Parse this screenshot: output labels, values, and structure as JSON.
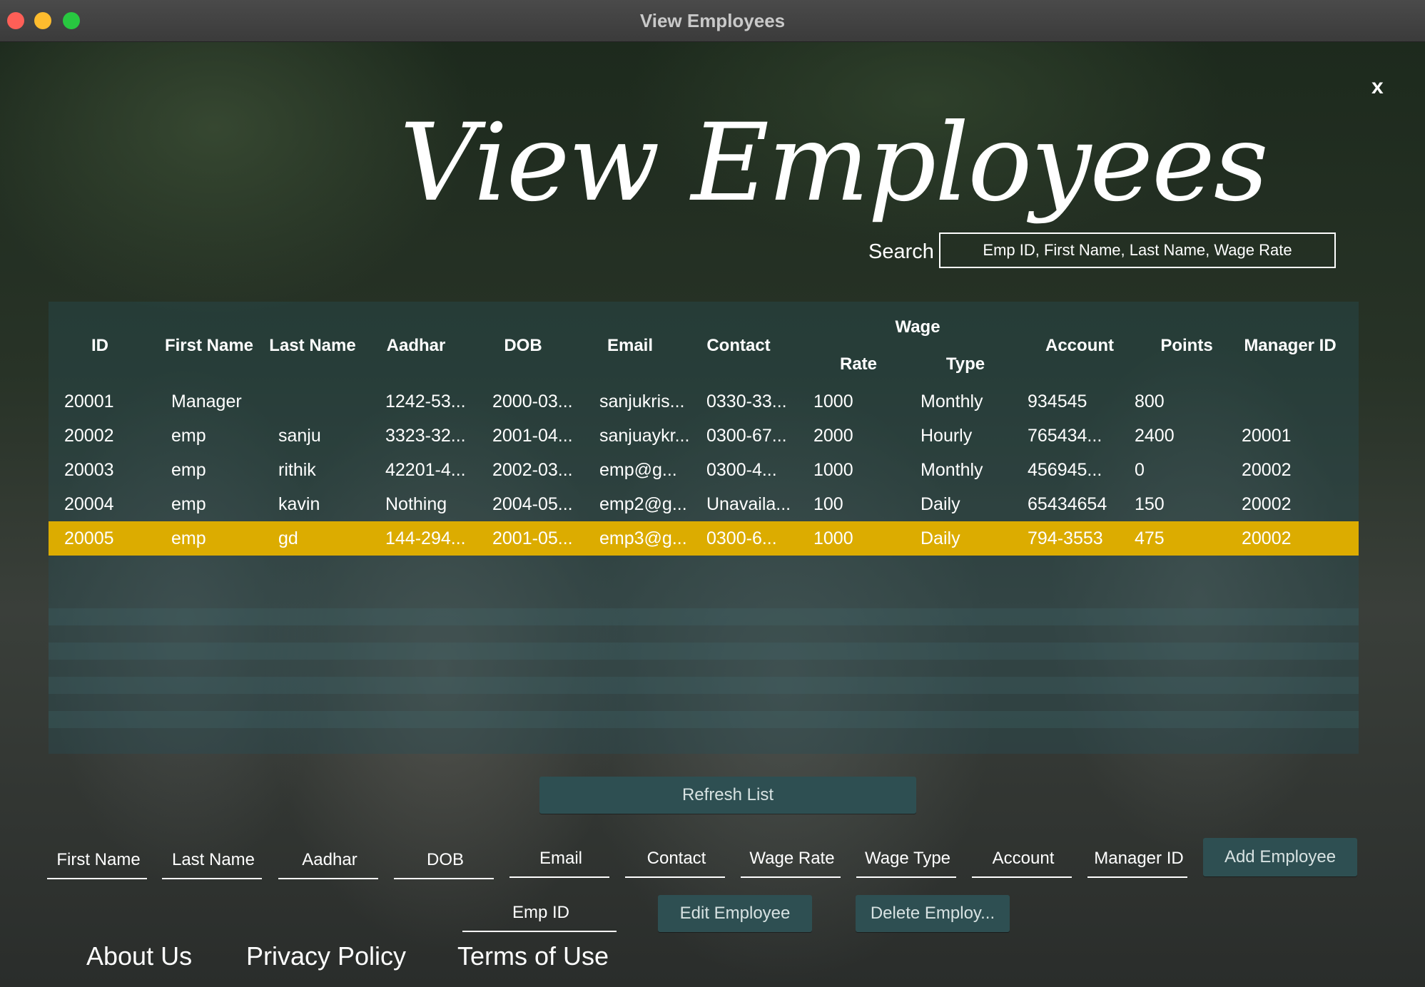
{
  "window": {
    "title": "View Employees"
  },
  "page": {
    "heading": "View Employees",
    "close": "x",
    "search_label": "Search",
    "search_placeholder": "Emp ID, First Name, Last Name, Wage Rate"
  },
  "table": {
    "headers": {
      "id": "ID",
      "first": "First Name",
      "last": "Last Name",
      "aadhar": "Aadhar",
      "dob": "DOB",
      "email": "Email",
      "contact": "Contact",
      "wage": "Wage",
      "rate": "Rate",
      "type": "Type",
      "account": "Account",
      "points": "Points",
      "manager": "Manager ID"
    },
    "rows": [
      [
        "20001",
        "Manager",
        "",
        "1242-53...",
        "2000-03...",
        "sanjukris...",
        "0330-33...",
        "1000",
        "Monthly",
        "934545",
        "800",
        ""
      ],
      [
        "20002",
        "emp",
        "sanju",
        "3323-32...",
        "2001-04...",
        "sanjuaykr...",
        "0300-67...",
        "2000",
        "Hourly",
        "765434...",
        "2400",
        "20001"
      ],
      [
        "20003",
        "emp",
        "rithik",
        "42201-4...",
        "2002-03...",
        "emp@g...",
        "0300-4...",
        "1000",
        "Monthly",
        "456945...",
        "0",
        "20002"
      ],
      [
        "20004",
        "emp",
        "kavin",
        "Nothing",
        "2004-05...",
        "emp2@g...",
        "Unavaila...",
        "100",
        "Daily",
        "65434654",
        "150",
        "20002"
      ],
      [
        "20005",
        "emp",
        "gd",
        "144-294...",
        "2001-05...",
        "emp3@g...",
        "0300-6...",
        "1000",
        "Daily",
        "794-3553",
        "475",
        "20002"
      ]
    ],
    "selected_row": 4,
    "selected_color": "#dcac00"
  },
  "actions": {
    "refresh": "Refresh List",
    "add": "Add Employee",
    "edit": "Edit Employee",
    "delete": "Delete Employ..."
  },
  "form": {
    "first_name": "First Name",
    "last_name": "Last Name",
    "aadhar": "Aadhar",
    "dob": "DOB",
    "email": "Email",
    "contact": "Contact",
    "wage_rate": "Wage Rate",
    "wage_type": "Wage Type",
    "account": "Account",
    "manager_id": "Manager ID",
    "emp_id": "Emp ID"
  },
  "footer": {
    "about": "About Us",
    "privacy": "Privacy Policy",
    "terms": "Terms of Use"
  }
}
